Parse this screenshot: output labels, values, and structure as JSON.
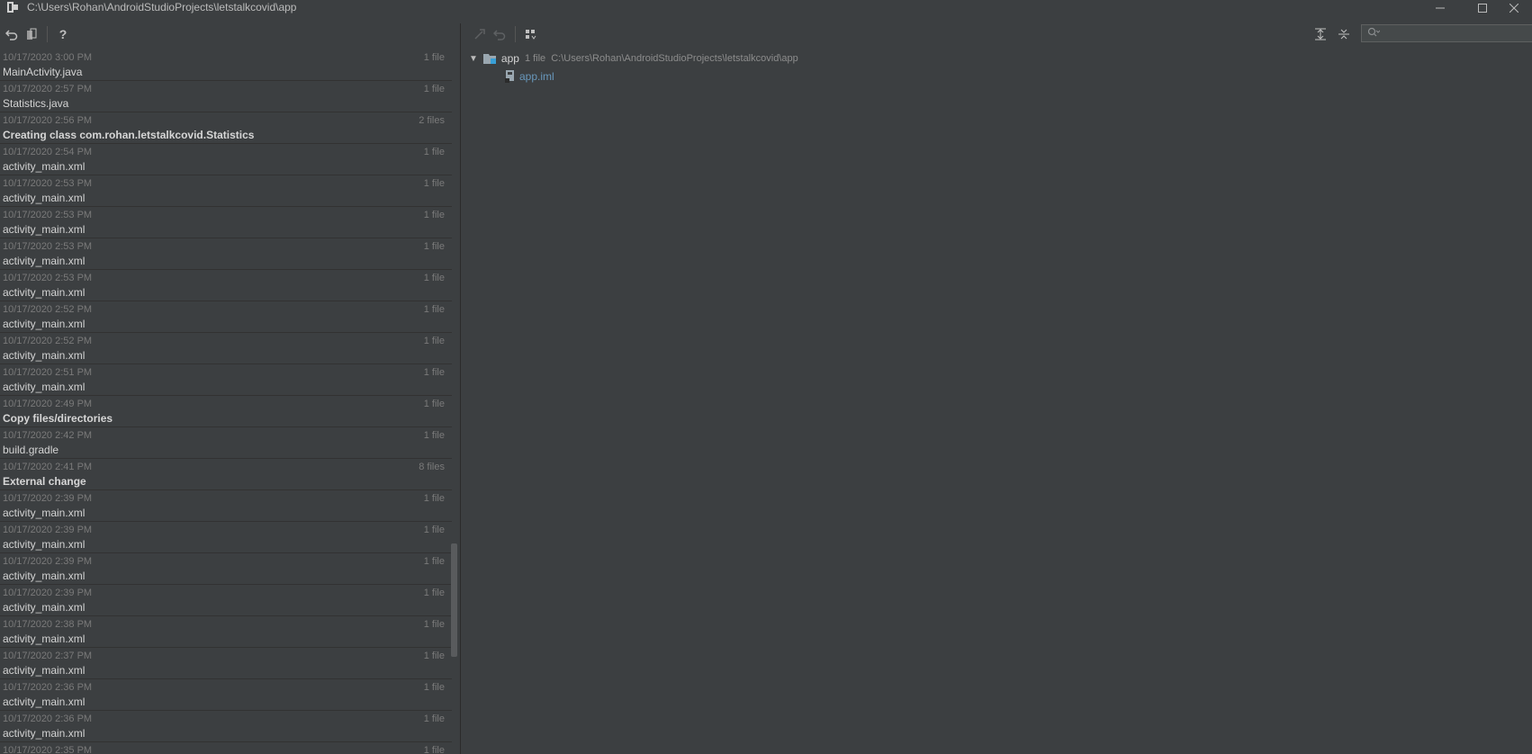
{
  "window": {
    "title_path": "C:\\Users\\Rohan\\AndroidStudioProjects\\letstalkcovid\\app",
    "controls": [
      "minimize-icon",
      "maximize-icon",
      "close-icon"
    ]
  },
  "toolbar_left": {
    "icons": [
      "revert-icon",
      "diff-icon",
      "help-icon"
    ],
    "help_label": "?"
  },
  "toolbar_right": {
    "icons": [
      "create-patch-icon",
      "revert-selected-icon",
      "group-by-icon"
    ]
  },
  "toolbar_far_right": {
    "icons": [
      "expand-all-icon",
      "collapse-all-icon"
    ]
  },
  "search": {
    "placeholder": ""
  },
  "history": [
    {
      "date": "10/17/2020 3:00 PM",
      "count": "1 file",
      "label": "MainActivity.java",
      "bold": false
    },
    {
      "date": "10/17/2020 2:57 PM",
      "count": "1 file",
      "label": "Statistics.java",
      "bold": false
    },
    {
      "date": "10/17/2020 2:56 PM",
      "count": "2 files",
      "label": "Creating class com.rohan.letstalkcovid.Statistics",
      "bold": true
    },
    {
      "date": "10/17/2020 2:54 PM",
      "count": "1 file",
      "label": "activity_main.xml",
      "bold": false
    },
    {
      "date": "10/17/2020 2:53 PM",
      "count": "1 file",
      "label": "activity_main.xml",
      "bold": false
    },
    {
      "date": "10/17/2020 2:53 PM",
      "count": "1 file",
      "label": "activity_main.xml",
      "bold": false
    },
    {
      "date": "10/17/2020 2:53 PM",
      "count": "1 file",
      "label": "activity_main.xml",
      "bold": false
    },
    {
      "date": "10/17/2020 2:53 PM",
      "count": "1 file",
      "label": "activity_main.xml",
      "bold": false
    },
    {
      "date": "10/17/2020 2:52 PM",
      "count": "1 file",
      "label": "activity_main.xml",
      "bold": false
    },
    {
      "date": "10/17/2020 2:52 PM",
      "count": "1 file",
      "label": "activity_main.xml",
      "bold": false
    },
    {
      "date": "10/17/2020 2:51 PM",
      "count": "1 file",
      "label": "activity_main.xml",
      "bold": false
    },
    {
      "date": "10/17/2020 2:49 PM",
      "count": "1 file",
      "label": "Copy files/directories",
      "bold": true
    },
    {
      "date": "10/17/2020 2:42 PM",
      "count": "1 file",
      "label": "build.gradle",
      "bold": false
    },
    {
      "date": "10/17/2020 2:41 PM",
      "count": "8 files",
      "label": "External change",
      "bold": true
    },
    {
      "date": "10/17/2020 2:39 PM",
      "count": "1 file",
      "label": "activity_main.xml",
      "bold": false
    },
    {
      "date": "10/17/2020 2:39 PM",
      "count": "1 file",
      "label": "activity_main.xml",
      "bold": false
    },
    {
      "date": "10/17/2020 2:39 PM",
      "count": "1 file",
      "label": "activity_main.xml",
      "bold": false
    },
    {
      "date": "10/17/2020 2:39 PM",
      "count": "1 file",
      "label": "activity_main.xml",
      "bold": false
    },
    {
      "date": "10/17/2020 2:38 PM",
      "count": "1 file",
      "label": "activity_main.xml",
      "bold": false
    },
    {
      "date": "10/17/2020 2:37 PM",
      "count": "1 file",
      "label": "activity_main.xml",
      "bold": false
    },
    {
      "date": "10/17/2020 2:36 PM",
      "count": "1 file",
      "label": "activity_main.xml",
      "bold": false
    },
    {
      "date": "10/17/2020 2:36 PM",
      "count": "1 file",
      "label": "activity_main.xml",
      "bold": false
    },
    {
      "date": "10/17/2020 2:35 PM",
      "count": "1 file",
      "label": "",
      "bold": false
    }
  ],
  "tree": {
    "root": {
      "name": "app",
      "count": "1 file",
      "path": "C:\\Users\\Rohan\\AndroidStudioProjects\\letstalkcovid\\app",
      "children": [
        {
          "name": "app.iml"
        }
      ]
    }
  },
  "colors": {
    "background": "#3c3f41",
    "text": "#bbbbbb",
    "muted_text": "#7a7a7a",
    "link_file": "#6897bb"
  }
}
